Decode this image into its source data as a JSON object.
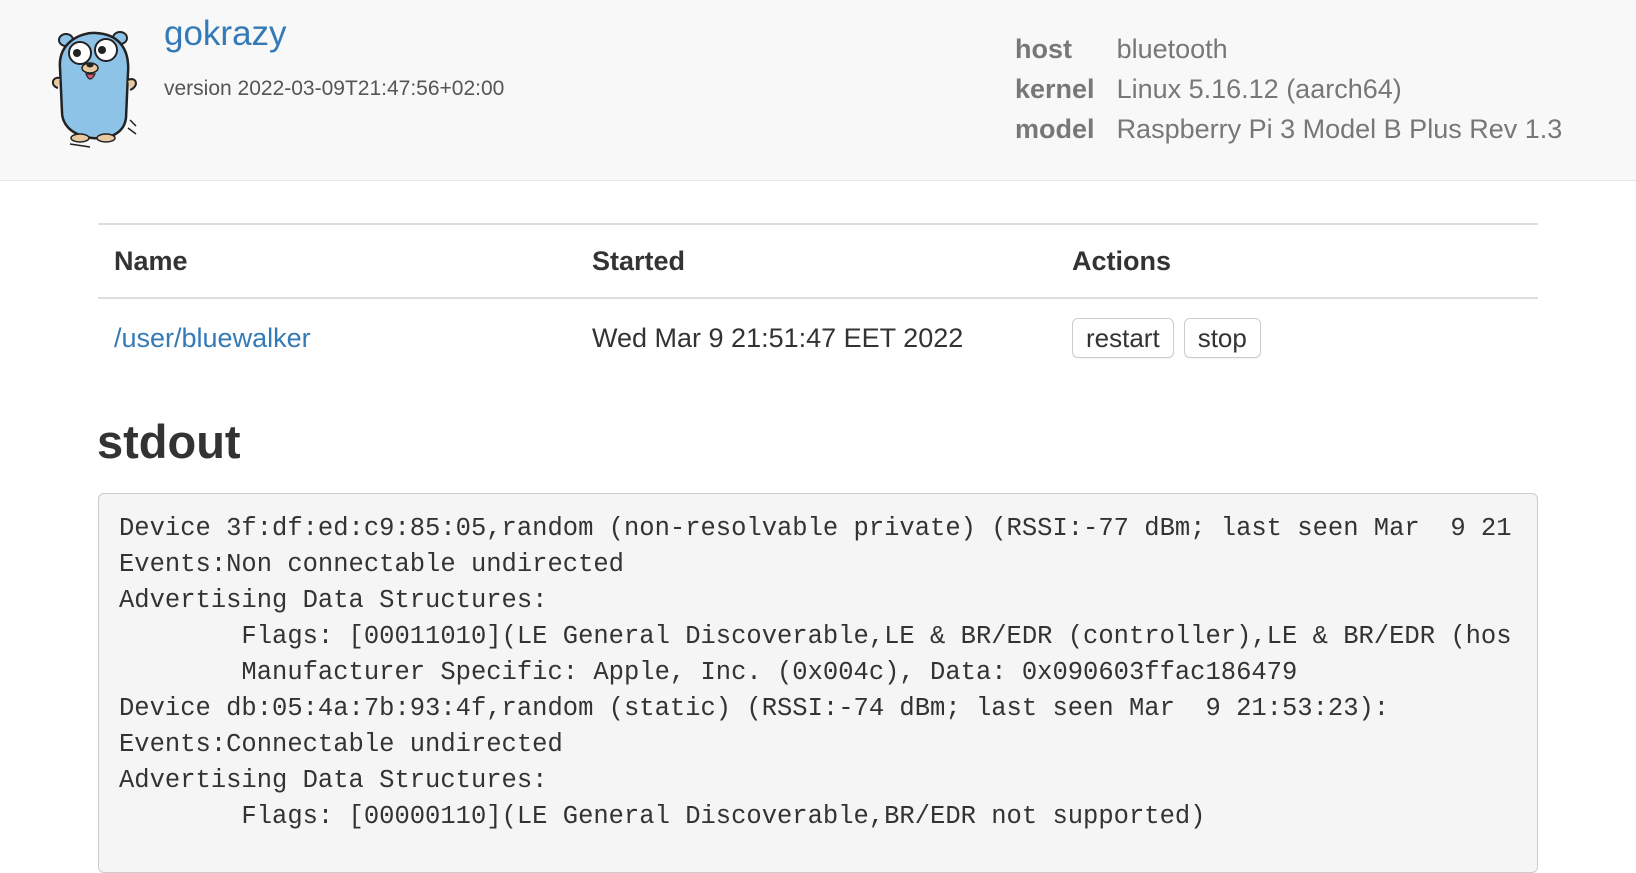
{
  "header": {
    "brand": "gokrazy",
    "version": "version 2022-03-09T21:47:56+02:00",
    "sysinfo": [
      {
        "key": "host",
        "value": "bluetooth"
      },
      {
        "key": "kernel",
        "value": "Linux 5.16.12 (aarch64)"
      },
      {
        "key": "model",
        "value": "Raspberry Pi 3 Model B Plus Rev 1.3"
      }
    ]
  },
  "services": {
    "columns": [
      "Name",
      "Started",
      "Actions"
    ],
    "rows": [
      {
        "name": "/user/bluewalker",
        "started": "Wed Mar 9 21:51:47 EET 2022",
        "actions": [
          "restart",
          "stop"
        ]
      }
    ]
  },
  "stdout": {
    "title": "stdout",
    "log": "Device 3f:df:ed:c9:85:05,random (non-resolvable private) (RSSI:-77 dBm; last seen Mar  9 21\nEvents:Non connectable undirected\nAdvertising Data Structures:\n        Flags: [00011010](LE General Discoverable,LE & BR/EDR (controller),LE & BR/EDR (hos\n        Manufacturer Specific: Apple, Inc. (0x004c), Data: 0x090603ffac186479\nDevice db:05:4a:7b:93:4f,random (static) (RSSI:-74 dBm; last seen Mar  9 21:53:23):\nEvents:Connectable undirected\nAdvertising Data Structures:\n        Flags: [00000110](LE General Discoverable,BR/EDR not supported)"
  },
  "colors": {
    "link": "#337ab7",
    "navbar_bg": "#f8f8f8",
    "log_bg": "#f5f5f5"
  },
  "icons": {
    "logo": "gopher-mascot-icon"
  }
}
